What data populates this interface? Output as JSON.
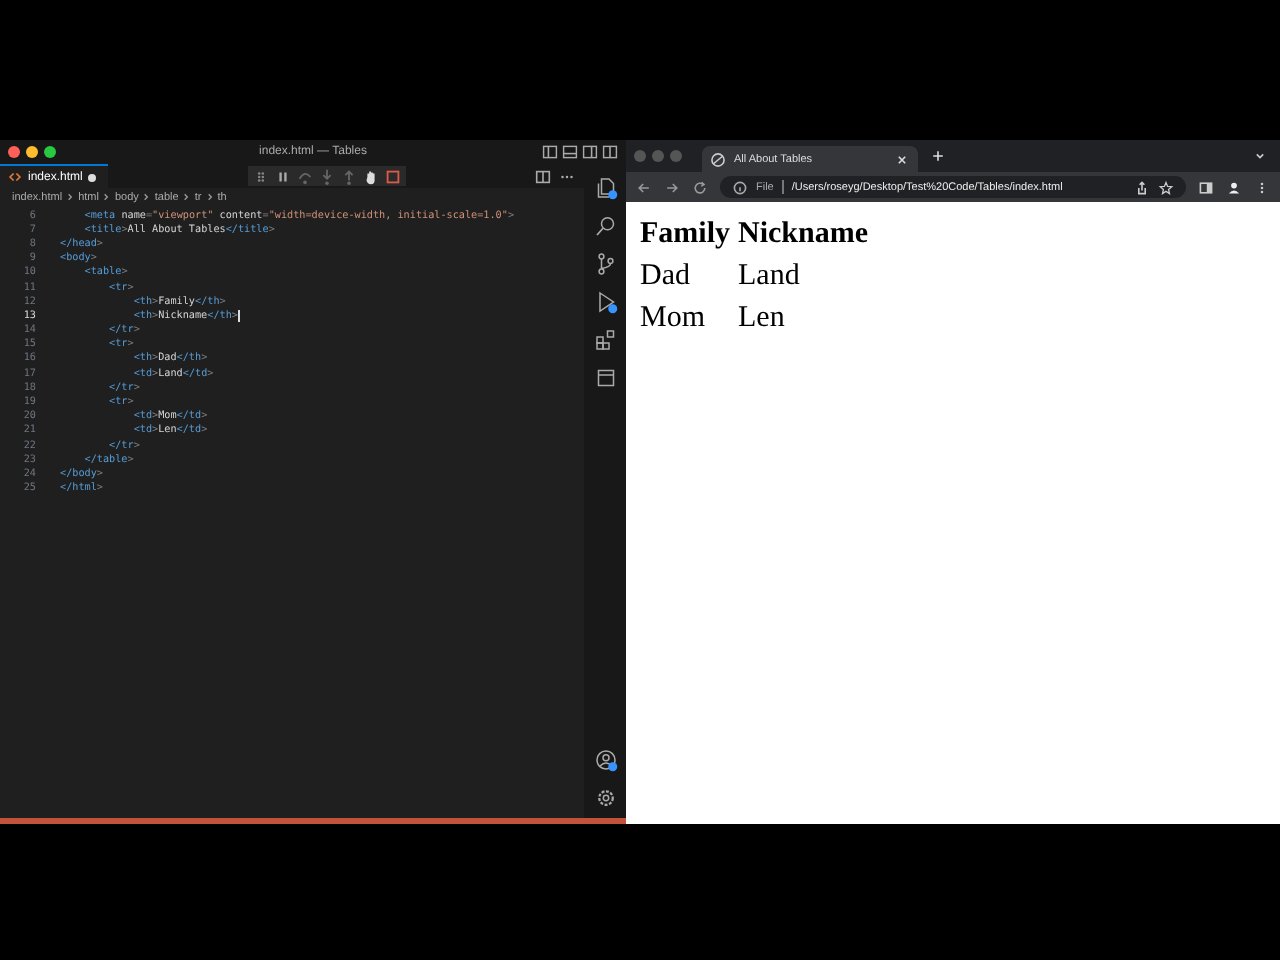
{
  "editor": {
    "window_title": "index.html — Tables",
    "tab": {
      "label": "index.html",
      "unsaved": true
    },
    "breadcrumbs": [
      "index.html",
      "html",
      "body",
      "table",
      "tr",
      "th"
    ],
    "lines": [
      {
        "number": "6",
        "code": "    <meta name=\"viewport\" content=\"width=device-width, initial-scale=1.0\">",
        "current": false
      },
      {
        "number": "7",
        "code": "    <title>All About Tables</title>",
        "current": false
      },
      {
        "number": "8",
        "code": "</head>",
        "current": false
      },
      {
        "number": "9",
        "code": "<body>",
        "current": false
      },
      {
        "number": "10",
        "code": "    <table>",
        "current": false
      },
      {
        "number": "11",
        "code": "        <tr>",
        "current": false
      },
      {
        "number": "12",
        "code": "            <th>Family</th>",
        "current": false
      },
      {
        "number": "13",
        "code": "            <th>Nickname</th>",
        "current": true
      },
      {
        "number": "14",
        "code": "        </tr>",
        "current": false
      },
      {
        "number": "15",
        "code": "        <tr>",
        "current": false
      },
      {
        "number": "16",
        "code": "            <th>Dad</th>",
        "current": false
      },
      {
        "number": "17",
        "code": "            <td>Land</td>",
        "current": false
      },
      {
        "number": "18",
        "code": "        </tr>",
        "current": false
      },
      {
        "number": "19",
        "code": "        <tr>",
        "current": false
      },
      {
        "number": "20",
        "code": "            <td>Mom</td>",
        "current": false
      },
      {
        "number": "21",
        "code": "            <td>Len</td>",
        "current": false
      },
      {
        "number": "22",
        "code": "        </tr>",
        "current": false
      },
      {
        "number": "23",
        "code": "    </table>",
        "current": false
      },
      {
        "number": "24",
        "code": "</body>",
        "current": false
      },
      {
        "number": "25",
        "code": "</html>",
        "current": false
      }
    ],
    "activity": [
      {
        "kind": "files",
        "badge": true
      },
      {
        "kind": "search",
        "badge": false
      },
      {
        "kind": "source",
        "badge": false
      },
      {
        "kind": "debug",
        "badge": true
      },
      {
        "kind": "extensions",
        "badge": false
      },
      {
        "kind": "panel",
        "badge": false
      }
    ],
    "activity_bottom": [
      {
        "kind": "account",
        "badge": true
      },
      {
        "kind": "settings",
        "badge": false
      }
    ]
  },
  "browser": {
    "tab": {
      "title": "All About Tables"
    },
    "address": {
      "scheme": "File",
      "url": "/Users/roseyg/Desktop/Test%20Code/Tables/index.html"
    },
    "page": {
      "table": {
        "header": [
          "Family",
          "Nickname"
        ],
        "rows": [
          [
            "Dad",
            "Land"
          ],
          [
            "Mom",
            "Len"
          ]
        ]
      }
    }
  }
}
